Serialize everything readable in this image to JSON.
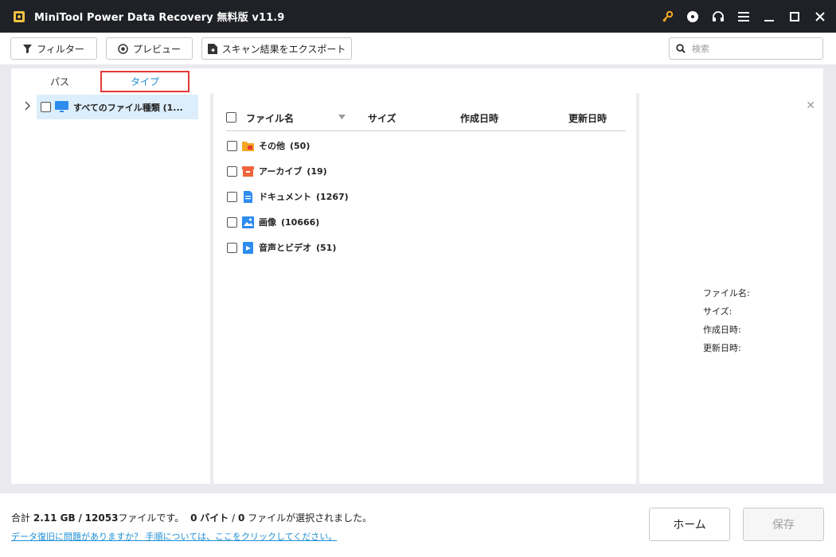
{
  "titlebar": {
    "title": "MiniTool Power Data Recovery 無料版 v11.9",
    "icons": [
      "key-icon",
      "disc-icon",
      "headset-icon",
      "menu-icon",
      "minimize-icon",
      "maximize-icon",
      "close-icon"
    ]
  },
  "toolbar": {
    "filter_label": "フィルター",
    "preview_label": "プレビュー",
    "export_label": "スキャン結果をエクスポート",
    "search_placeholder": "検索"
  },
  "tabs": {
    "path_label": "パス",
    "type_label": "タイプ"
  },
  "tree": {
    "root_label": "すべてのファイル種類 (1..."
  },
  "list": {
    "headers": {
      "name": "ファイル名",
      "size": "サイズ",
      "created": "作成日時",
      "modified": "更新日時"
    },
    "items": [
      {
        "label": "その他",
        "count": "(50)",
        "icon": "folder-other-icon",
        "color": "#f5a623"
      },
      {
        "label": "アーカイブ",
        "count": "(19)",
        "icon": "archive-icon",
        "color": "#f0643c"
      },
      {
        "label": "ドキュメント",
        "count": "(1267)",
        "icon": "document-icon",
        "color": "#2d8cf0"
      },
      {
        "label": "画像",
        "count": "(10666)",
        "icon": "image-icon",
        "color": "#2d8cf0"
      },
      {
        "label": "音声とビデオ",
        "count": "(51)",
        "icon": "video-icon",
        "color": "#2d8cf0"
      }
    ]
  },
  "preview": {
    "file_name_label": "ファイル名:",
    "size_label": "サイズ:",
    "created_label": "作成日時:",
    "modified_label": "更新日時:"
  },
  "footer": {
    "total_prefix": "合計",
    "total_size": "2.11 GB",
    "separator": "/",
    "total_files": "12053",
    "files_text": "ファイルです。",
    "selected_bytes": "0",
    "bytes_unit": "バイト",
    "selected_files": "0",
    "selected_text": "ファイルが選択されました。",
    "help_link": "データ復旧に問題がありますか？ 手順については、ここをクリックしてください。",
    "home_label": "ホーム",
    "save_label": "保存"
  },
  "colors": {
    "titlebar_bg": "#1f2127",
    "accent": "#1e8fd4",
    "tab_highlight": "#e53935",
    "selected_row": "#dceefb"
  }
}
